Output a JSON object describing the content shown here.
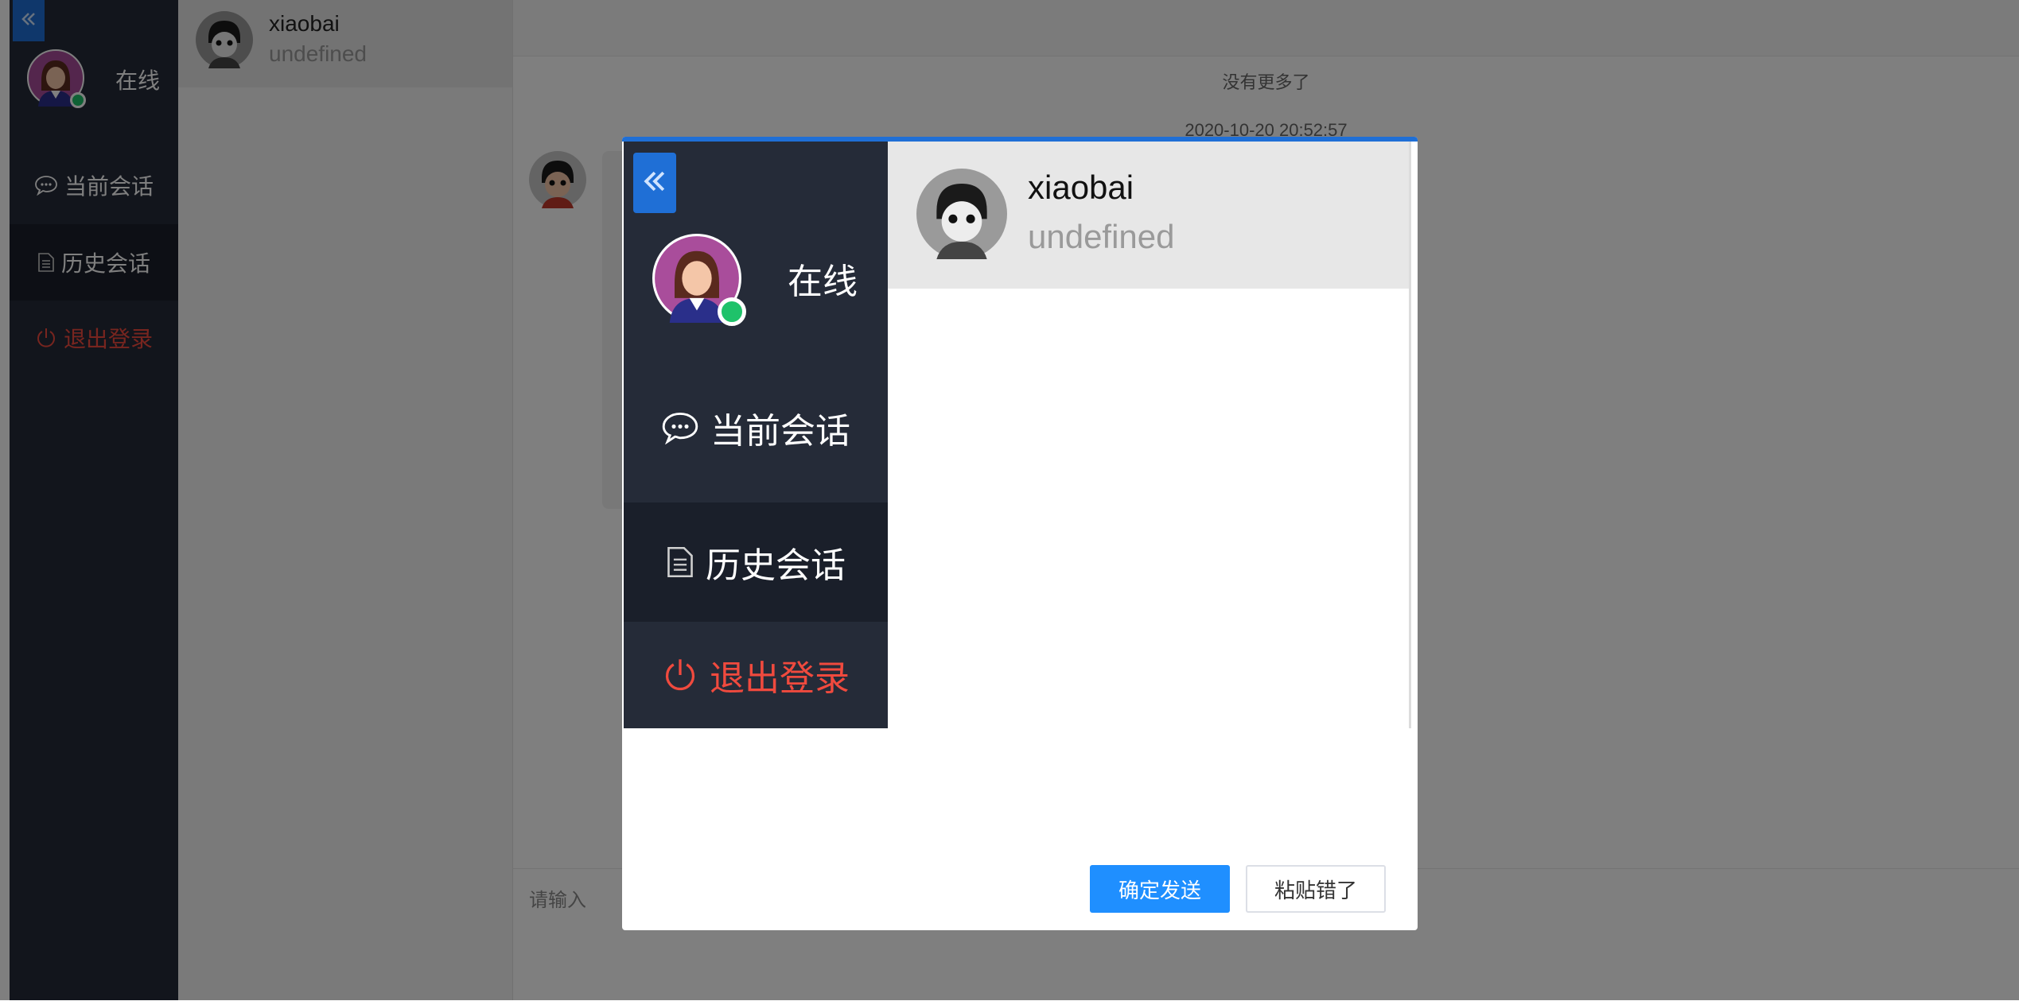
{
  "sidebar": {
    "collapse_icon": "double-chevron-left-icon",
    "status": "在线",
    "items": [
      {
        "label": "当前会话",
        "icon": "chat-bubble-icon"
      },
      {
        "label": "历史会话",
        "icon": "document-icon"
      },
      {
        "label": "退出登录",
        "icon": "power-icon"
      }
    ]
  },
  "conversation_list": {
    "items": [
      {
        "name": "xiaobai",
        "subtitle": "undefined"
      }
    ]
  },
  "chat": {
    "no_more": "没有更多了",
    "timestamp": "2020-10-20 20:52:57",
    "input_placeholder": "请输入"
  },
  "dialog": {
    "preview": {
      "status": "在线",
      "items": [
        {
          "label": "当前会话"
        },
        {
          "label": "历史会话"
        },
        {
          "label": "退出登录"
        }
      ],
      "conversation": {
        "name": "xiaobai",
        "subtitle": "undefined"
      }
    },
    "confirm_label": "确定发送",
    "cancel_label": "粘贴错了"
  },
  "colors": {
    "sidebar_bg": "#252b38",
    "accent_blue": "#1f6fd6",
    "button_blue": "#1f8fff",
    "online_green": "#1fc26a",
    "logout_red": "#f04a3e"
  }
}
